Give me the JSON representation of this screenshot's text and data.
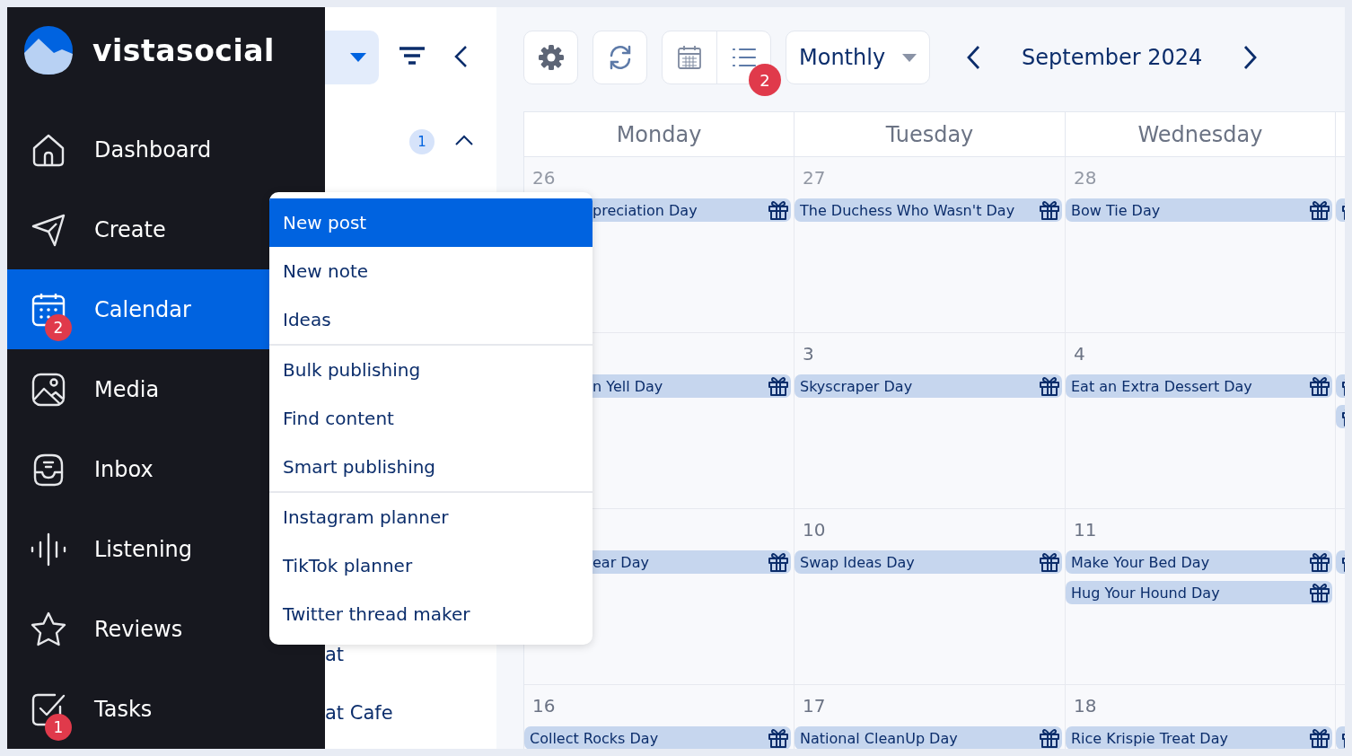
{
  "sidebar": {
    "brand": "vistasocial",
    "items": [
      {
        "label": "Dashboard",
        "selected": false
      },
      {
        "label": "Create",
        "selected": false
      },
      {
        "label": "Calendar",
        "selected": true,
        "badge": "2"
      },
      {
        "label": "Media",
        "selected": false
      },
      {
        "label": "Inbox",
        "selected": false
      },
      {
        "label": "Listening",
        "selected": false
      },
      {
        "label": "Reviews",
        "selected": false
      },
      {
        "label": "Tasks",
        "selected": false,
        "badge": "1"
      }
    ]
  },
  "side_panel": {
    "count": "1",
    "items": [
      "at",
      "at Cafe"
    ]
  },
  "create_menu": {
    "groups": [
      [
        {
          "label": "New post",
          "selected": true
        },
        {
          "label": "New note",
          "selected": false
        },
        {
          "label": "Ideas",
          "selected": false
        }
      ],
      [
        {
          "label": "Bulk publishing",
          "selected": false
        },
        {
          "label": "Find content",
          "selected": false
        },
        {
          "label": "Smart publishing",
          "selected": false
        }
      ],
      [
        {
          "label": "Instagram planner",
          "selected": false
        },
        {
          "label": "TikTok planner",
          "selected": false
        },
        {
          "label": "Twitter thread maker",
          "selected": false
        }
      ]
    ]
  },
  "toolbar": {
    "list_badge": "2",
    "view": "Monthly",
    "period": "September 2024"
  },
  "calendar": {
    "weekdays": [
      "Monday",
      "Tuesday",
      "Wednesday"
    ],
    "weeks": [
      [
        {
          "day": "26",
          "muted": true,
          "events": [
            {
              "kind": "holiday",
              "title": "preciation Day",
              "covered": true
            }
          ]
        },
        {
          "day": "27",
          "muted": true,
          "events": [
            {
              "kind": "holiday",
              "title": "The Duchess Who Wasn't Day",
              "covered": false
            }
          ]
        },
        {
          "day": "28",
          "muted": true,
          "events": [
            {
              "kind": "holiday",
              "title": "Bow Tie Day",
              "covered": false
            }
          ]
        },
        {
          "events": [
            {
              "kind": "holiday"
            }
          ]
        }
      ],
      [
        {
          "events": [
            {
              "kind": "holiday",
              "title": "n Yell Day",
              "covered": true
            }
          ]
        },
        {
          "day": "3",
          "muted": false,
          "events": [
            {
              "kind": "holiday",
              "title": "Skyscraper Day",
              "covered": false
            }
          ]
        },
        {
          "day": "4",
          "muted": false,
          "events": [
            {
              "kind": "holiday",
              "title": "Eat an Extra Dessert Day",
              "covered": false
            }
          ]
        },
        {
          "events": [
            {
              "kind": "holiday"
            },
            {
              "kind": "holiday"
            }
          ]
        }
      ],
      [
        {
          "events": [
            {
              "kind": "holiday",
              "title": "ear Day",
              "covered": true
            }
          ]
        },
        {
          "day": "10",
          "muted": false,
          "events": [
            {
              "kind": "holiday",
              "title": "Swap Ideas Day",
              "covered": false
            }
          ]
        },
        {
          "day": "11",
          "muted": false,
          "events": [
            {
              "kind": "holiday",
              "title": "Make Your Bed Day",
              "covered": false
            },
            {
              "kind": "holiday",
              "title": "Hug Your Hound Day",
              "covered": false
            }
          ]
        },
        {
          "events": [
            {
              "kind": "holiday"
            }
          ]
        }
      ],
      [
        {
          "day": "16",
          "muted": false,
          "events": [
            {
              "kind": "holiday",
              "title": "Collect Rocks Day",
              "covered": false
            }
          ]
        },
        {
          "day": "17",
          "muted": false,
          "events": [
            {
              "kind": "holiday",
              "title": "National CleanUp Day",
              "covered": false
            }
          ]
        },
        {
          "day": "18",
          "muted": false,
          "events": [
            {
              "kind": "holiday",
              "title": "Rice Krispie Treat Day",
              "covered": false
            }
          ]
        },
        {
          "events": [
            {
              "kind": "holiday"
            }
          ]
        }
      ]
    ]
  }
}
